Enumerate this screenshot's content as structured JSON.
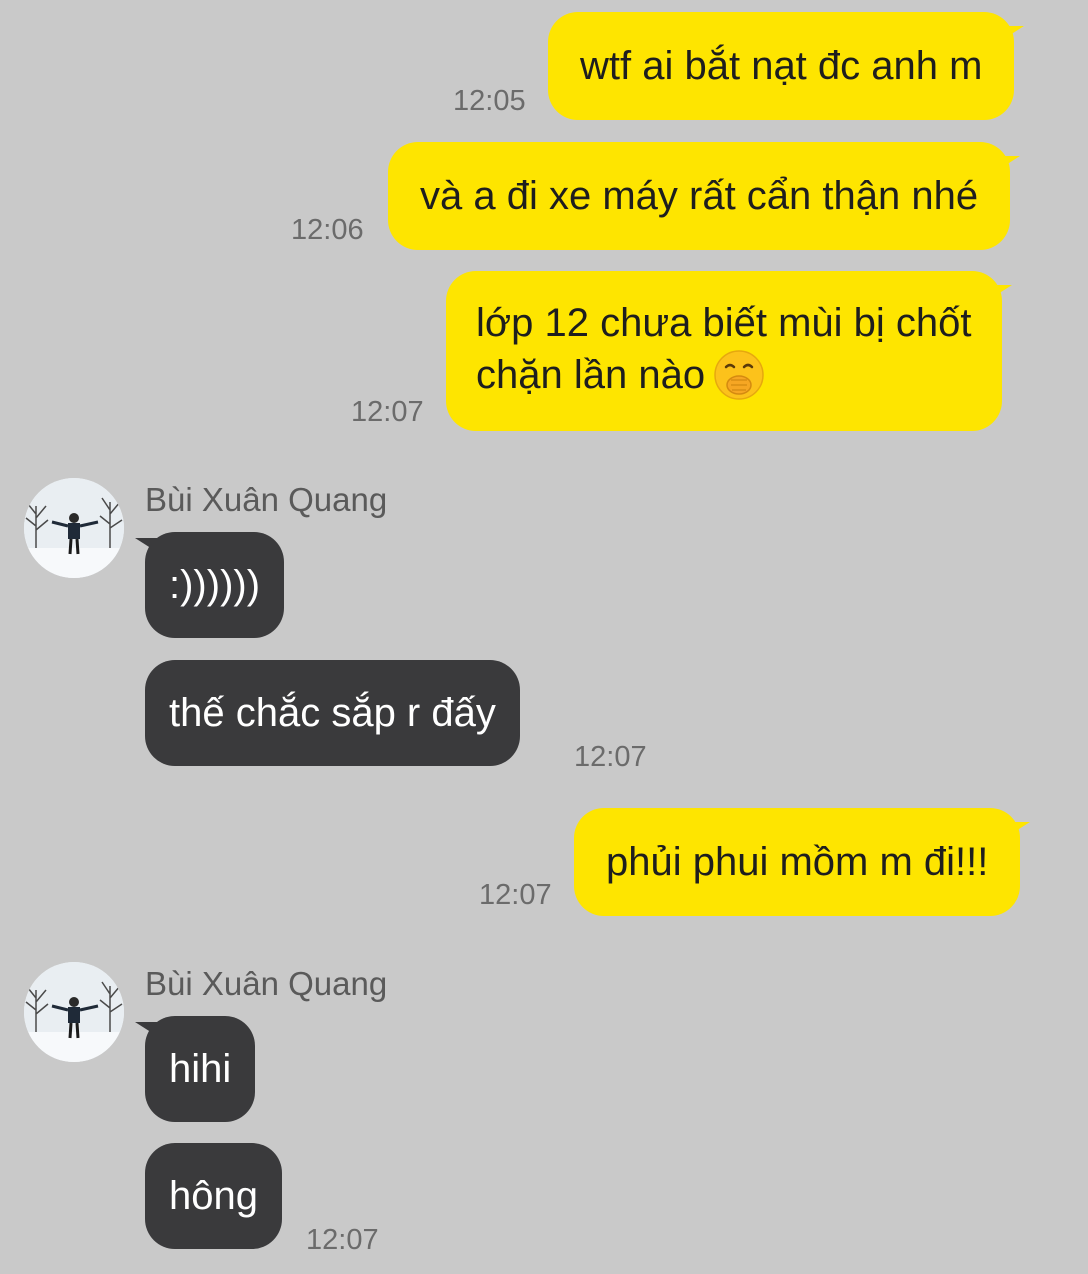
{
  "messages": [
    {
      "side": "out",
      "text": "wtf ai bắt nạt đc anh m",
      "time": "12:05"
    },
    {
      "side": "out",
      "text": "và a đi xe máy rất cẩn thận nhé",
      "time": "12:06"
    },
    {
      "side": "out",
      "lines": [
        "lớp 12 chưa biết mùi bị chốt",
        "chặn lần nào"
      ],
      "emoji": "face-with-hand-over-mouth-icon",
      "time": "12:07"
    },
    {
      "side": "in",
      "sender": "Bùi Xuân Quang",
      "text": ":))))))"
    },
    {
      "side": "in",
      "text": "thế chắc sắp r đấy",
      "time": "12:07"
    },
    {
      "side": "out",
      "text": "phủi phui mồm m đi!!!",
      "time": "12:07"
    },
    {
      "side": "in",
      "sender": "Bùi Xuân Quang",
      "text": "hihi"
    },
    {
      "side": "in",
      "text": "hông",
      "time": "12:07"
    }
  ],
  "colors": {
    "background": "#c9c9c9",
    "outgoing_bubble": "#fee500",
    "incoming_bubble": "#3a3a3c",
    "timestamp": "#6b6b6b"
  }
}
